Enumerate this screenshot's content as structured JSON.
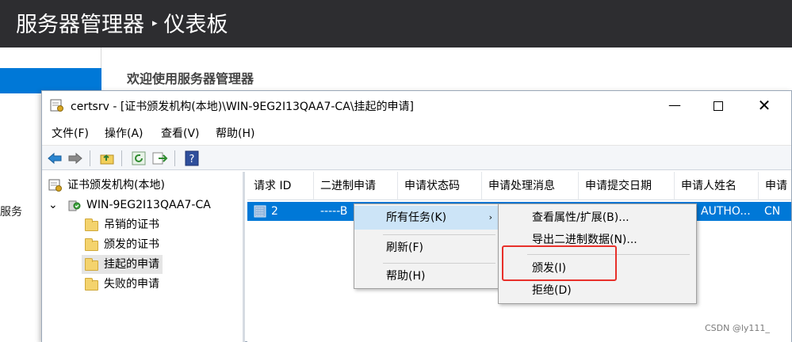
{
  "server_manager": {
    "title": "服务器管理器",
    "separator": "▸",
    "page": "仪表板",
    "welcome": "欢迎使用服务器管理器",
    "left_label": "服务"
  },
  "window": {
    "title": "certsrv - [证书颁发机构(本地)\\WIN-9EG2I13QAA7-CA\\挂起的申请]",
    "controls": {
      "minimize": "—",
      "close": "✕"
    }
  },
  "menu": [
    "文件(F)",
    "操作(A)",
    "查看(V)",
    "帮助(H)"
  ],
  "toolbar_icons": [
    "back-arrow-icon",
    "forward-arrow-icon",
    "up-folder-icon",
    "refresh-icon",
    "export-list-icon",
    "help-icon"
  ],
  "toolbar_help_glyph": "?",
  "tree": {
    "root": "证书颁发机构(本地)",
    "ca": "WIN-9EG2I13QAA7-CA",
    "expander": "⌄",
    "folders": [
      "吊销的证书",
      "颁发的证书",
      "挂起的申请",
      "失败的申请"
    ],
    "selected": "挂起的申请"
  },
  "list": {
    "columns": [
      "请求 ID",
      "二进制申请",
      "申请状态码",
      "申请处理消息",
      "申请提交日期",
      "申请人姓名",
      "申请"
    ],
    "row": {
      "id": "2",
      "binary": "-----B",
      "requester": "AUTHO...",
      "name_tail": "CN"
    }
  },
  "context_menu": {
    "items": [
      "所有任务(K)",
      "刷新(F)",
      "帮助(H)"
    ],
    "submenu_arrow": "›",
    "highlighted": "所有任务(K)"
  },
  "submenu": {
    "items": [
      "查看属性/扩展(B)...",
      "导出二进制数据(N)...",
      "颁发(I)",
      "拒绝(D)"
    ],
    "highlighted_box": "颁发(I)"
  },
  "watermark": "CSDN @ly111_",
  "colors": {
    "accent": "#0078d7",
    "highlight_box": "#e8302a",
    "header_bg": "#2d2d30"
  }
}
